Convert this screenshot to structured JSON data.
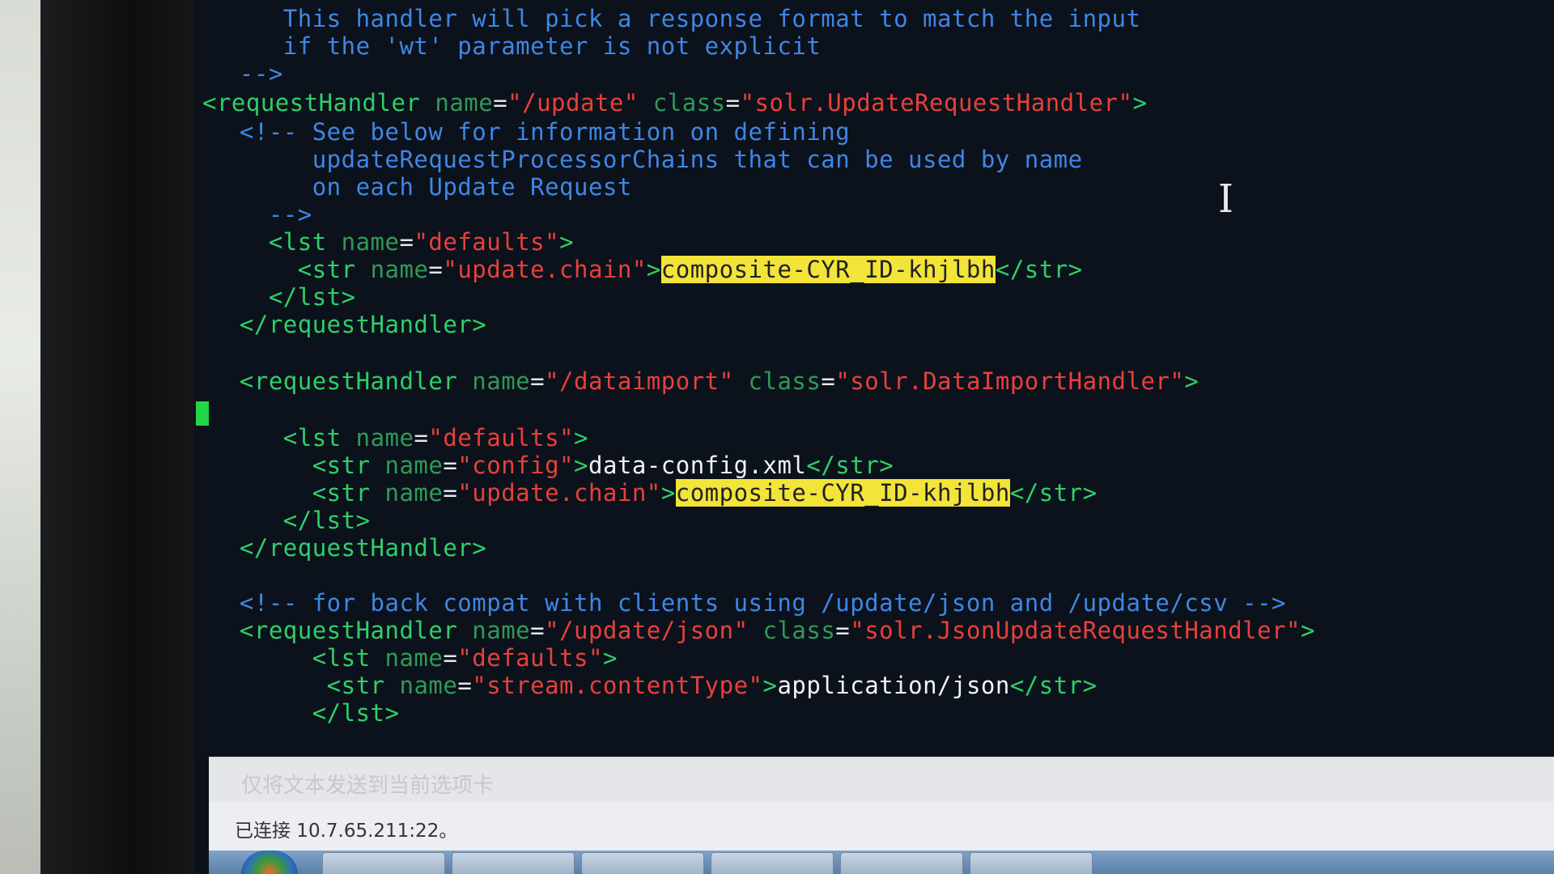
{
  "editor": {
    "lines": [
      [
        {
          "c": "comment",
          "t": "     This handler will pick a response format to match the input"
        }
      ],
      [
        {
          "c": "comment",
          "t": "     if the 'wt' parameter is not explicit"
        }
      ],
      [
        {
          "c": "comment",
          "t": "  -->"
        }
      ],
      [
        {
          "c": "tag",
          "t": "<requestHandler "
        },
        {
          "c": "attr",
          "t": "name"
        },
        {
          "c": "eq",
          "t": "="
        },
        {
          "c": "str",
          "t": "\"/update\""
        },
        {
          "c": "attr",
          "t": " class"
        },
        {
          "c": "eq",
          "t": "="
        },
        {
          "c": "str",
          "t": "\"solr.UpdateRequestHandler\""
        },
        {
          "c": "tag",
          "t": ">"
        }
      ],
      [
        {
          "c": "comment",
          "t": "  <!-- See below for information on defining"
        }
      ],
      [
        {
          "c": "comment",
          "t": "       updateRequestProcessorChains that can be used by name"
        }
      ],
      [
        {
          "c": "comment",
          "t": "       on each Update Request"
        }
      ],
      [
        {
          "c": "comment",
          "t": "    -->"
        }
      ],
      [
        {
          "c": "tag",
          "t": "    <lst "
        },
        {
          "c": "attr",
          "t": "name"
        },
        {
          "c": "eq",
          "t": "="
        },
        {
          "c": "str",
          "t": "\"defaults\""
        },
        {
          "c": "tag",
          "t": ">"
        }
      ],
      [
        {
          "c": "tag",
          "t": "      <str "
        },
        {
          "c": "attr",
          "t": "name"
        },
        {
          "c": "eq",
          "t": "="
        },
        {
          "c": "str",
          "t": "\"update.chain\""
        },
        {
          "c": "tag",
          "t": ">"
        },
        {
          "c": "hl",
          "t": "composite-CYR_ID-khjlbh"
        },
        {
          "c": "tag",
          "t": "</str>"
        }
      ],
      [
        {
          "c": "tag",
          "t": "    </lst>"
        }
      ],
      [
        {
          "c": "tag",
          "t": "  </requestHandler>"
        }
      ],
      [
        {
          "c": "text",
          "t": ""
        }
      ],
      [
        {
          "c": "tag",
          "t": "  <requestHandler "
        },
        {
          "c": "attr",
          "t": "name"
        },
        {
          "c": "eq",
          "t": "="
        },
        {
          "c": "str",
          "t": "\"/dataimport\""
        },
        {
          "c": "attr",
          "t": " class"
        },
        {
          "c": "eq",
          "t": "="
        },
        {
          "c": "str",
          "t": "\"solr.DataImportHandler\""
        },
        {
          "c": "tag",
          "t": ">"
        }
      ],
      [
        {
          "c": "text",
          "t": ""
        }
      ],
      [
        {
          "c": "tag",
          "t": "     <lst "
        },
        {
          "c": "attr",
          "t": "name"
        },
        {
          "c": "eq",
          "t": "="
        },
        {
          "c": "str",
          "t": "\"defaults\""
        },
        {
          "c": "tag",
          "t": ">"
        }
      ],
      [
        {
          "c": "tag",
          "t": "       <str "
        },
        {
          "c": "attr",
          "t": "name"
        },
        {
          "c": "eq",
          "t": "="
        },
        {
          "c": "str",
          "t": "\"config\""
        },
        {
          "c": "tag",
          "t": ">"
        },
        {
          "c": "text",
          "t": "data-config.xml"
        },
        {
          "c": "tag",
          "t": "</str>"
        }
      ],
      [
        {
          "c": "tag",
          "t": "       <str "
        },
        {
          "c": "attr",
          "t": "name"
        },
        {
          "c": "eq",
          "t": "="
        },
        {
          "c": "str",
          "t": "\"update.chain\""
        },
        {
          "c": "tag",
          "t": ">"
        },
        {
          "c": "hl",
          "t": "composite-CYR_ID-khjlbh"
        },
        {
          "c": "tag",
          "t": "</str>"
        }
      ],
      [
        {
          "c": "tag",
          "t": "     </lst>"
        }
      ],
      [
        {
          "c": "tag",
          "t": "  </requestHandler>"
        }
      ],
      [
        {
          "c": "text",
          "t": ""
        }
      ],
      [
        {
          "c": "comment",
          "t": "  <!-- for back compat with clients using /update/json and /update/csv -->"
        }
      ],
      [
        {
          "c": "tag",
          "t": "  <requestHandler "
        },
        {
          "c": "attr",
          "t": "name"
        },
        {
          "c": "eq",
          "t": "="
        },
        {
          "c": "str",
          "t": "\"/update/json\""
        },
        {
          "c": "attr",
          "t": " class"
        },
        {
          "c": "eq",
          "t": "="
        },
        {
          "c": "str",
          "t": "\"solr.JsonUpdateRequestHandler\""
        },
        {
          "c": "tag",
          "t": ">"
        }
      ],
      [
        {
          "c": "tag",
          "t": "       <lst "
        },
        {
          "c": "attr",
          "t": "name"
        },
        {
          "c": "eq",
          "t": "="
        },
        {
          "c": "str",
          "t": "\"defaults\""
        },
        {
          "c": "tag",
          "t": ">"
        }
      ],
      [
        {
          "c": "tag",
          "t": "        <str "
        },
        {
          "c": "attr",
          "t": "name"
        },
        {
          "c": "eq",
          "t": "="
        },
        {
          "c": "str",
          "t": "\"stream.contentType\""
        },
        {
          "c": "tag",
          "t": ">"
        },
        {
          "c": "text",
          "t": "application/json"
        },
        {
          "c": "tag",
          "t": "</str>"
        }
      ],
      [
        {
          "c": "tag",
          "t": "       </lst>"
        }
      ]
    ]
  },
  "send_bar": {
    "placeholder": "仅将文本发送到当前选项卡"
  },
  "status": {
    "connection": "已连接 10.7.65.211:22。"
  },
  "colors": {
    "background": "#0c121b",
    "comment": "#3f86e6",
    "tag": "#2fcf6a",
    "string": "#e8403c",
    "highlight": "#f3e43a"
  }
}
